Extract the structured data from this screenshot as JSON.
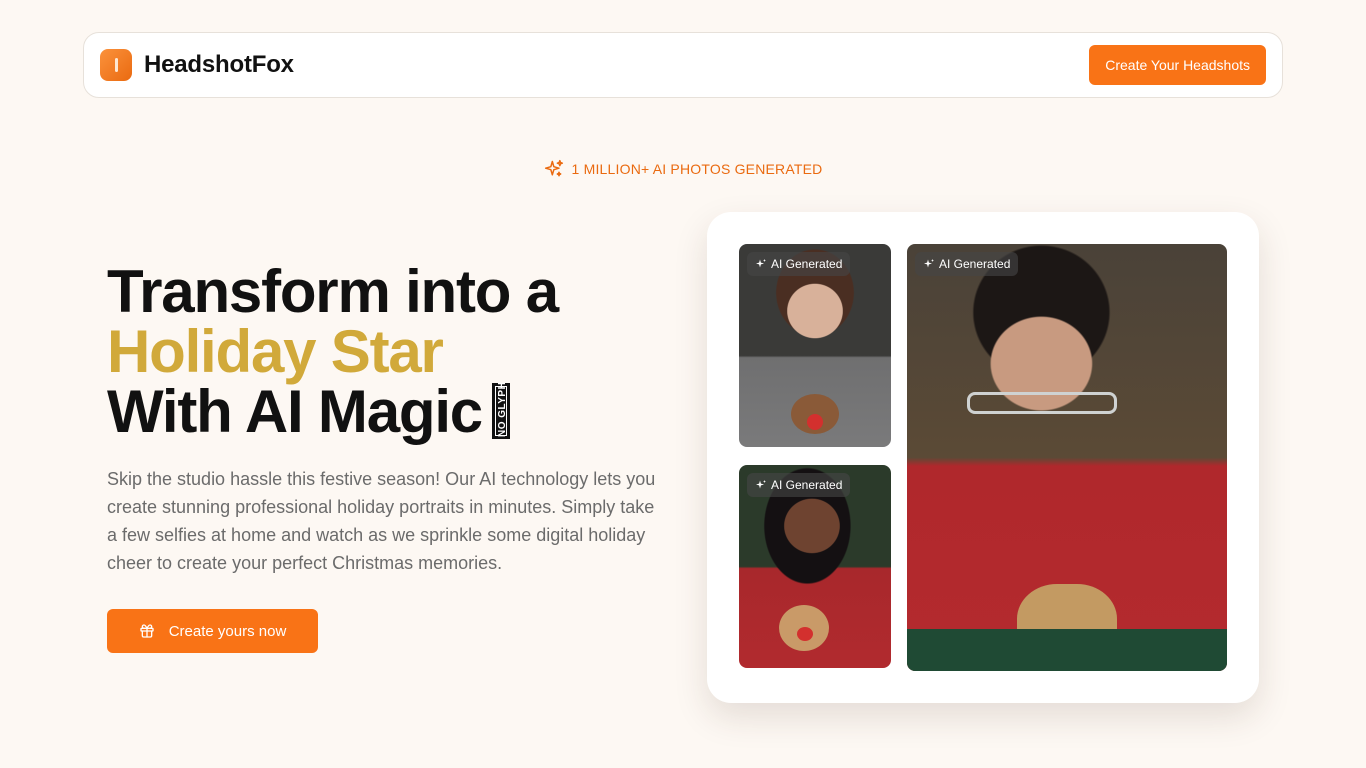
{
  "brand": {
    "name": "HeadshotFox",
    "logo_icon": "fox-logo-icon",
    "accent": "#f97316"
  },
  "nav": {
    "cta_label": "Create Your Headshots"
  },
  "badge": {
    "icon": "sparkles-icon",
    "text": "1 MILLION+ AI PHOTOS GENERATED"
  },
  "hero": {
    "title_line1": "Transform into a",
    "title_line2": "Holiday Star",
    "title_line3": "With AI Magic",
    "missing_glyph_text": "NO GLYPH",
    "highlight_color": "#d1a93a",
    "description": "Skip the studio hassle this festive season! Our AI technology lets you create stunning professional holiday portraits in minutes. Simply take a few selfies at home and watch as we sprinkle some digital holiday cheer to create your perfect Christmas memories.",
    "cta_label": "Create yours now",
    "cta_icon": "gift-icon"
  },
  "gallery": {
    "photos": [
      {
        "tag": "AI Generated",
        "subject": "woman in reindeer sweater"
      },
      {
        "tag": "AI Generated",
        "subject": "woman in red reindeer sweater"
      },
      {
        "tag": "AI Generated",
        "subject": "man with glasses in reindeer sweater"
      }
    ],
    "tag_icon": "sparkle-icon"
  }
}
